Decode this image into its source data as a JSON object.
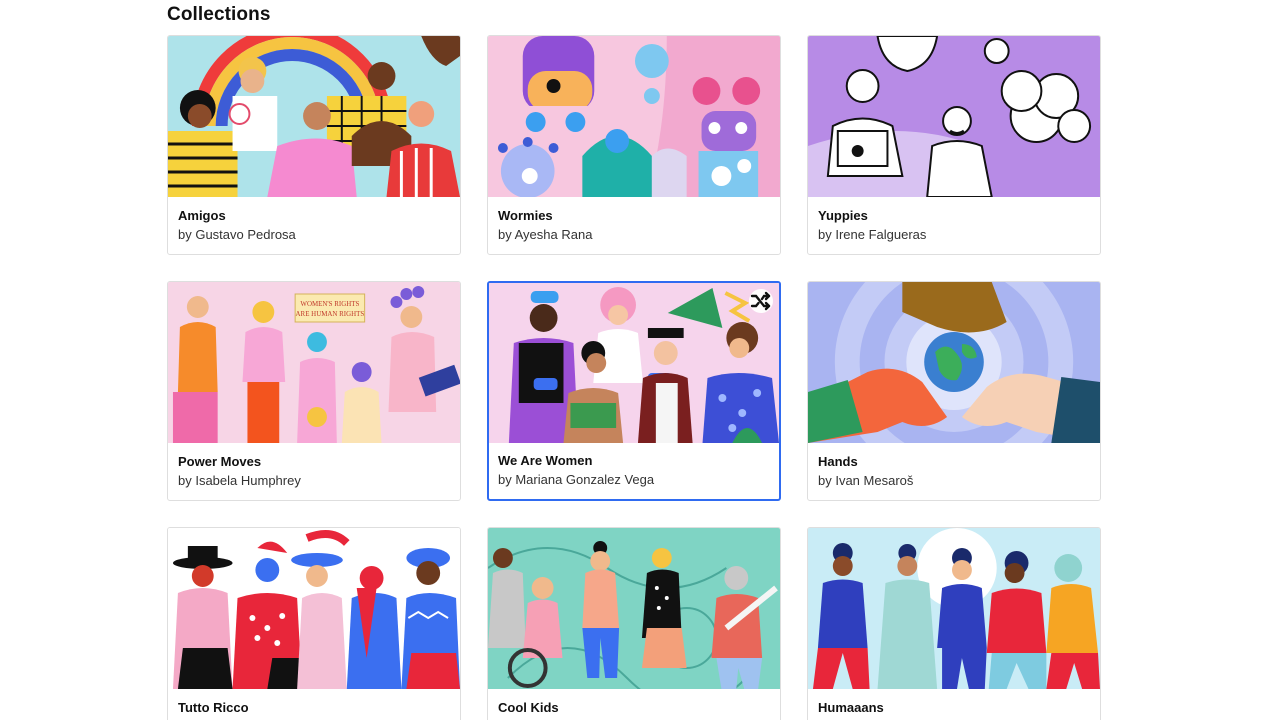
{
  "section": {
    "title": "Collections"
  },
  "cards": [
    {
      "title": "Amigos",
      "author": "by Gustavo Pedrosa",
      "thumb_bg": "#aee3ea"
    },
    {
      "title": "Wormies",
      "author": "by Ayesha Rana",
      "thumb_bg": "#f7c7df"
    },
    {
      "title": "Yuppies",
      "author": "by Irene Falgueras",
      "thumb_bg": "#b78be6"
    },
    {
      "title": "Power Moves",
      "author": "by Isabela Humphrey",
      "thumb_bg": "#f7d5e6",
      "sign_text_1": "WOMEN'S RIGHTS",
      "sign_text_2": "ARE HUMAN RIGHTS"
    },
    {
      "title": "We Are Women",
      "author": "by Mariana Gonzalez Vega",
      "thumb_bg": "#f6d4ec",
      "selected": true
    },
    {
      "title": "Hands",
      "author": "by Ivan Mesaroš",
      "thumb_bg": "#a9b4f1"
    },
    {
      "title": "Tutto Ricco",
      "author": "",
      "thumb_bg": "#ffffff"
    },
    {
      "title": "Cool Kids",
      "author": "",
      "thumb_bg": "#7fd4c4"
    },
    {
      "title": "Humaaans",
      "author": "",
      "thumb_bg": "#c9ecf6"
    }
  ],
  "icons": {
    "shuffle": "shuffle-icon"
  },
  "colors": {
    "selected_border": "#2f6bf1",
    "card_border": "#dedede"
  }
}
